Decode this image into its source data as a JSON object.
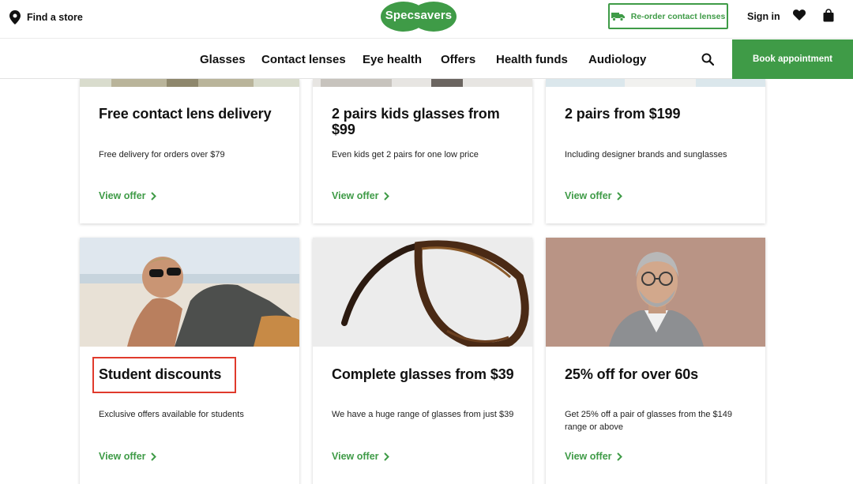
{
  "header": {
    "find_store": "Find a store",
    "logo_text": "Specsavers",
    "reorder_label": "Re-order contact lenses",
    "sign_in": "Sign in"
  },
  "nav": {
    "items": [
      "Glasses",
      "Contact lenses",
      "Eye health",
      "Offers",
      "Health funds",
      "Audiology"
    ],
    "book_label": "Book appointment"
  },
  "offers": [
    {
      "title": "Free contact lens delivery",
      "description": "Free delivery for orders over $79",
      "link": "View offer"
    },
    {
      "title": "2 pairs kids glasses from $99",
      "description": "Even kids get 2 pairs for one low price",
      "link": "View offer"
    },
    {
      "title": "2 pairs from $199",
      "description": "Including designer brands and sunglasses",
      "link": "View offer"
    },
    {
      "title": "Student discounts",
      "description": "Exclusive offers available for students",
      "link": "View offer",
      "highlighted": true
    },
    {
      "title": "Complete glasses from $39",
      "description": "We have a huge range of glasses from just $39",
      "link": "View offer"
    },
    {
      "title": "25% off for over 60s",
      "description": "Get 25% off a pair of glasses from the $149 range or above",
      "link": "View offer"
    }
  ],
  "icons": {
    "find_store": "map-pin-icon",
    "reorder": "delivery-truck-icon",
    "wishlist": "heart-icon",
    "bag": "shopping-bag-icon",
    "search": "search-icon",
    "link_arrow": "chevron-right-icon"
  },
  "colors": {
    "brand_green": "#3f9b47",
    "highlight_red": "#e03a2c",
    "text": "#111111"
  }
}
